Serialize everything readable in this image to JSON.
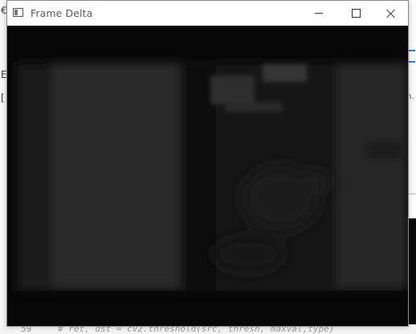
{
  "window": {
    "title": "Frame Delta",
    "controls": {
      "minimize": "minimize",
      "maximize": "maximize",
      "close": "close"
    }
  },
  "background": {
    "left_chars": [
      "€",
      "E",
      "["
    ],
    "right_text": "n.",
    "code_line": {
      "line_number": "59",
      "text": "# ret, dst = cv2.threshold(src, thresh, maxval,type)"
    }
  },
  "icons": {
    "app": "window-app-icon",
    "minimize": "minimize-icon",
    "maximize": "maximize-icon",
    "close": "close-icon"
  },
  "colors": {
    "frame_background": "#080808",
    "window_background": "#ffffff"
  }
}
